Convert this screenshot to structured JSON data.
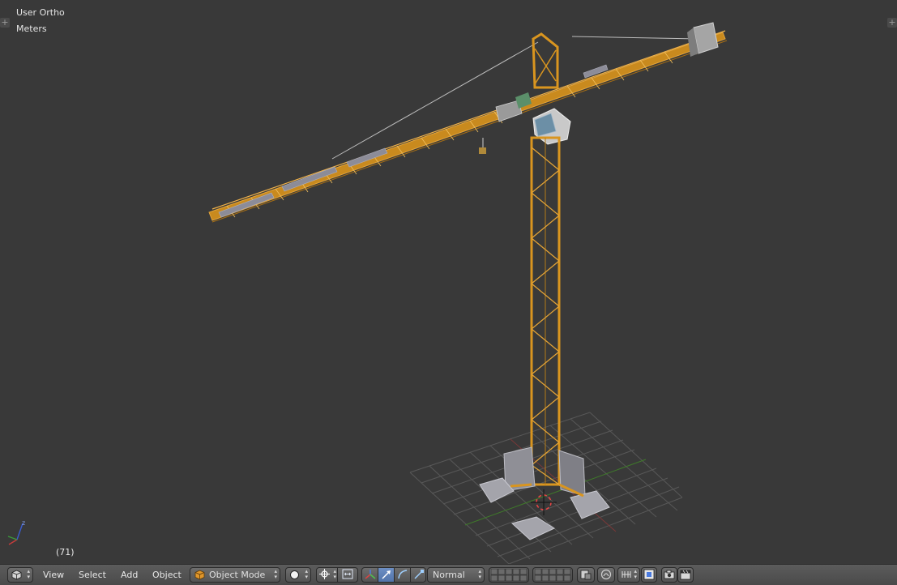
{
  "viewport": {
    "view_label": "User Ortho",
    "units_label": "Meters",
    "frame_label": "(71)"
  },
  "header": {
    "menus": [
      {
        "label": "View"
      },
      {
        "label": "Select"
      },
      {
        "label": "Add"
      },
      {
        "label": "Object"
      }
    ],
    "mode": "Object Mode",
    "orientation": "Normal"
  },
  "colors": {
    "viewport_bg": "#393939",
    "crane_orange": "#d9951f",
    "grid": "#555555",
    "grid_x_axis": "#8b3a3a",
    "grid_y_axis": "#5a9a3a",
    "concrete": "#9a9a9a",
    "active_button": "#5680c2"
  }
}
